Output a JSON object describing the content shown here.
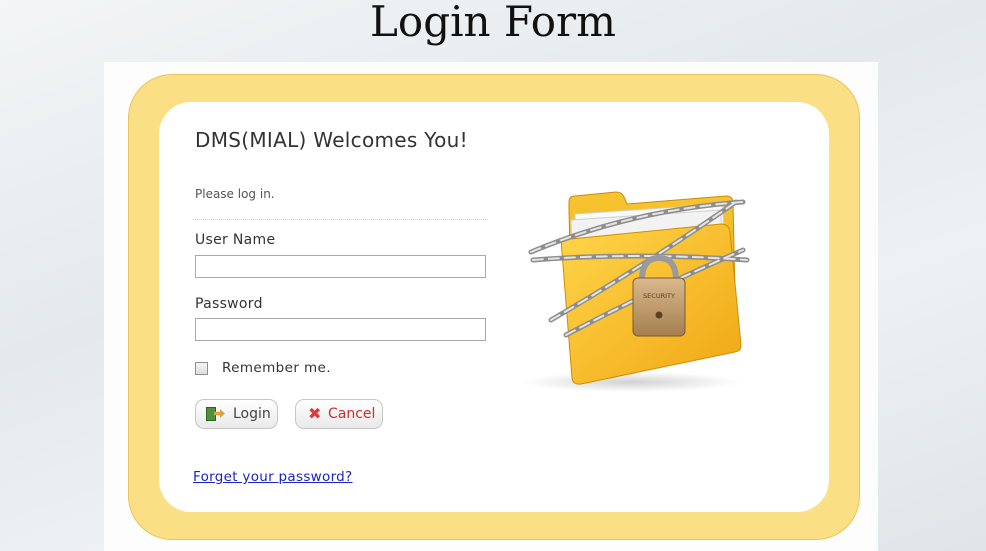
{
  "slide": {
    "title": "Login Form"
  },
  "login": {
    "heading": "DMS(MIAL) Welcomes You!",
    "subtext": "Please log in.",
    "username_label": "User Name",
    "username_value": "",
    "password_label": "Password",
    "password_value": "",
    "remember_label": "Remember me.",
    "remember_checked": false,
    "login_button": "Login",
    "cancel_button": "Cancel",
    "forgot_link": "Forget your password?"
  },
  "illustration": {
    "icon": "locked-folder-icon",
    "padlock_label": "SECURITY"
  },
  "colors": {
    "frame": "#fbdf84",
    "card": "#ffffff",
    "link": "#1a22c9",
    "cancel": "#cc2f2f",
    "folder": "#f5b81c"
  }
}
